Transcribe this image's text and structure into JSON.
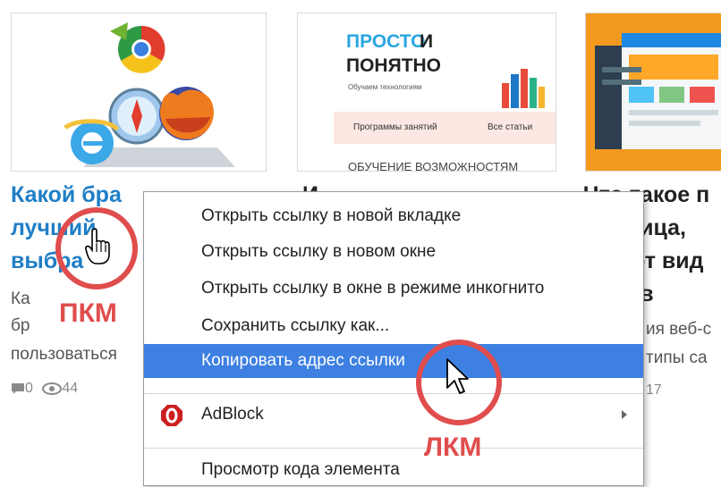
{
  "cards": [
    {
      "title_lines": [
        "Какой бра",
        "лучший",
        "выбра"
      ],
      "excerpt_lines": [
        "Ка",
        "бр",
        "пользоваться"
      ],
      "comments": "0",
      "views": "44"
    },
    {
      "thumb": {
        "brand_a": "ПРОСТО",
        "brand_b": "И",
        "brand_c": "ПОНЯТНО",
        "tagline": "Обучаем технологиям",
        "btn_programs": "Программы занятий",
        "btn_all": "Все статьи",
        "caption": "ОБУЧЕНИЕ ВОЗМОЖНОСТЯМ"
      },
      "title_lines": [
        "И"
      ]
    },
    {
      "title_lines": [
        "Что такое п",
        "ница, ",
        "ют вид",
        "ов"
      ],
      "excerpt_lines": [
        "ия веб-с",
        "типы са"
      ],
      "date": "17"
    }
  ],
  "context_menu": {
    "items": [
      "Открыть ссылку в новой вкладке",
      "Открыть ссылку в новом окне",
      "Открыть ссылку в окне в режиме инкогнито",
      "Сохранить ссылку как...",
      "Копировать адрес ссылки"
    ],
    "adblock": "AdBlock",
    "inspect": "Просмотр кода элемента"
  },
  "annotations": {
    "right_click": "ПКМ",
    "left_click": "ЛКМ"
  },
  "colors": {
    "link": "#1f7ec6",
    "highlight": "#3d80e2",
    "annotation": "#e04d4d",
    "opera_red": "#cc1f1f"
  }
}
